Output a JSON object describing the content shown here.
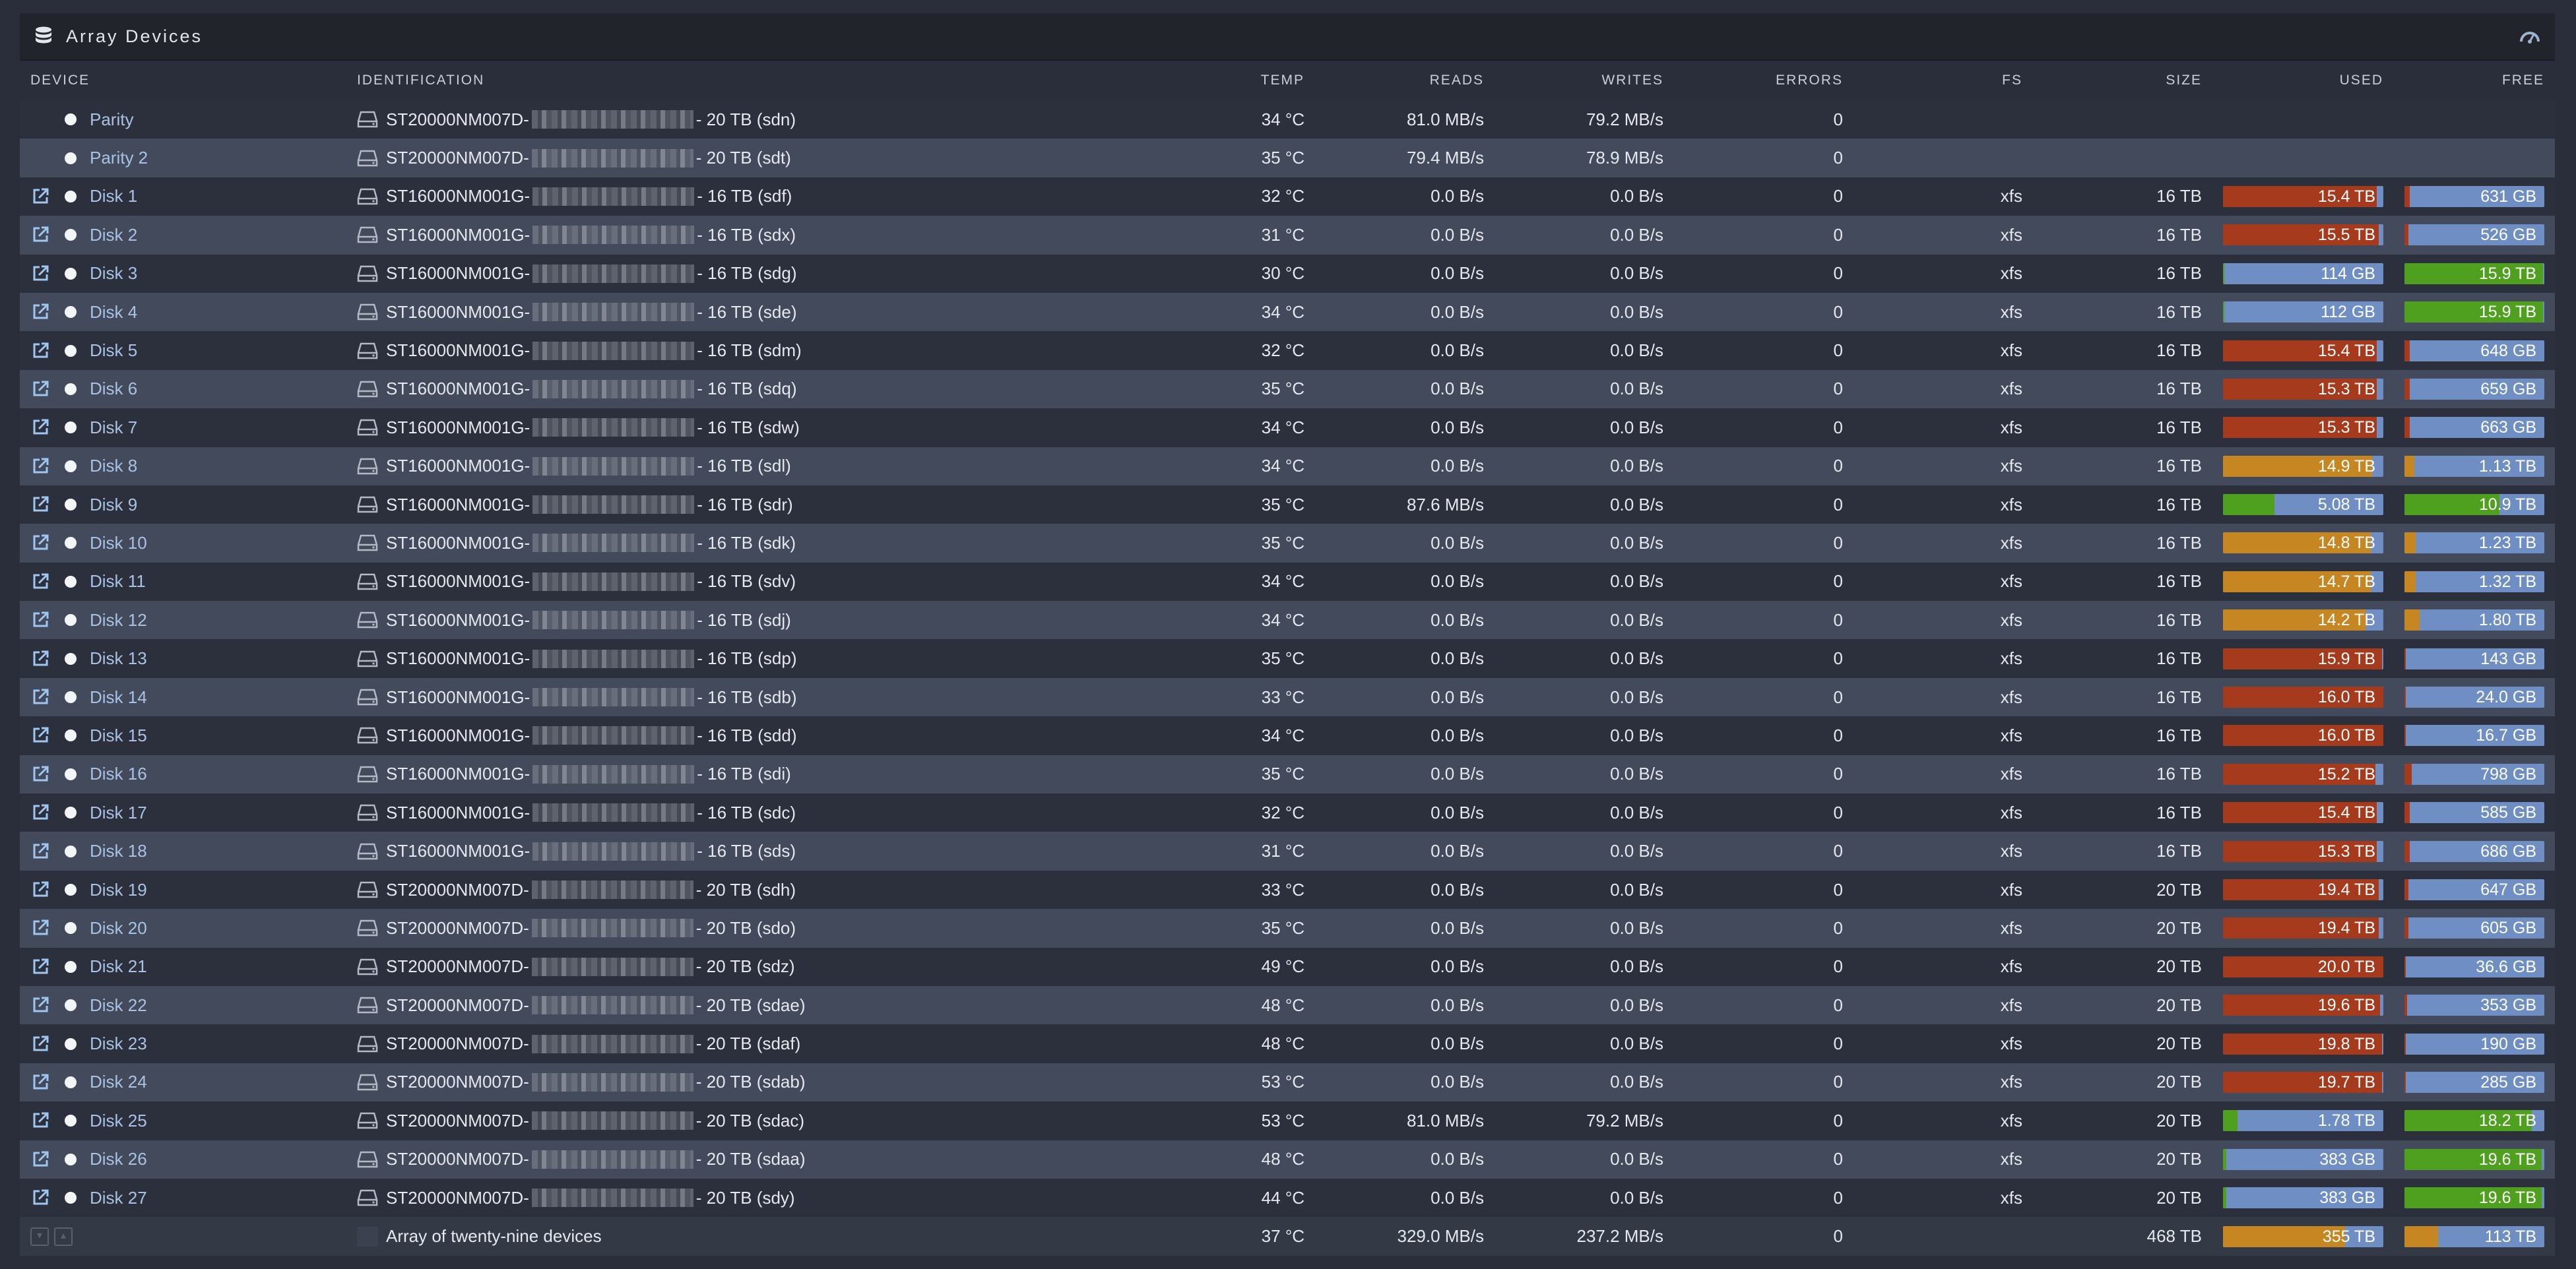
{
  "panel": {
    "title": "Array Devices",
    "icon": "database-icon",
    "settings_icon": "gauge-icon"
  },
  "columns": {
    "device": "DEVICE",
    "identification": "IDENTIFICATION",
    "temp": "TEMP",
    "reads": "READS",
    "writes": "WRITES",
    "errors": "ERRORS",
    "fs": "FS",
    "size": "SIZE",
    "used": "USED",
    "free": "FREE"
  },
  "colors": {
    "red": "#a53a1d",
    "orange": "#c68622",
    "green": "#4fa01e",
    "blue": "#6f8fc4",
    "row_odd": "#2c303c",
    "row_even": "#434a5c"
  },
  "rows": [
    {
      "name": "Parity",
      "link": false,
      "model": "ST20000NM007D-",
      "suffix": "- 20 TB (sdn)",
      "temp": "34 °C",
      "reads": "81.0 MB/s",
      "writes": "79.2 MB/s",
      "errors": "0",
      "fs": "",
      "size": "",
      "used": null,
      "free": null
    },
    {
      "name": "Parity 2",
      "link": false,
      "model": "ST20000NM007D-",
      "suffix": "- 20 TB (sdt)",
      "temp": "35 °C",
      "reads": "79.4 MB/s",
      "writes": "78.9 MB/s",
      "errors": "0",
      "fs": "",
      "size": "",
      "used": null,
      "free": null
    },
    {
      "name": "Disk 1",
      "link": true,
      "model": "ST16000NM001G-",
      "suffix": "- 16 TB (sdf)",
      "temp": "32 °C",
      "reads": "0.0 B/s",
      "writes": "0.0 B/s",
      "errors": "0",
      "fs": "xfs",
      "size": "16 TB",
      "used": {
        "label": "15.4 TB",
        "pct": 96,
        "color": "red"
      },
      "free": {
        "label": "631 GB",
        "pct": 4,
        "color": "red"
      }
    },
    {
      "name": "Disk 2",
      "link": true,
      "model": "ST16000NM001G-",
      "suffix": "- 16 TB (sdx)",
      "temp": "31 °C",
      "reads": "0.0 B/s",
      "writes": "0.0 B/s",
      "errors": "0",
      "fs": "xfs",
      "size": "16 TB",
      "used": {
        "label": "15.5 TB",
        "pct": 97,
        "color": "red"
      },
      "free": {
        "label": "526 GB",
        "pct": 3,
        "color": "red"
      }
    },
    {
      "name": "Disk 3",
      "link": true,
      "model": "ST16000NM001G-",
      "suffix": "- 16 TB (sdg)",
      "temp": "30 °C",
      "reads": "0.0 B/s",
      "writes": "0.0 B/s",
      "errors": "0",
      "fs": "xfs",
      "size": "16 TB",
      "used": {
        "label": "114 GB",
        "pct": 1,
        "color": "green"
      },
      "free": {
        "label": "15.9 TB",
        "pct": 99,
        "color": "green"
      }
    },
    {
      "name": "Disk 4",
      "link": true,
      "model": "ST16000NM001G-",
      "suffix": "- 16 TB (sde)",
      "temp": "34 °C",
      "reads": "0.0 B/s",
      "writes": "0.0 B/s",
      "errors": "0",
      "fs": "xfs",
      "size": "16 TB",
      "used": {
        "label": "112 GB",
        "pct": 1,
        "color": "green"
      },
      "free": {
        "label": "15.9 TB",
        "pct": 99,
        "color": "green"
      }
    },
    {
      "name": "Disk 5",
      "link": true,
      "model": "ST16000NM001G-",
      "suffix": "- 16 TB (sdm)",
      "temp": "32 °C",
      "reads": "0.0 B/s",
      "writes": "0.0 B/s",
      "errors": "0",
      "fs": "xfs",
      "size": "16 TB",
      "used": {
        "label": "15.4 TB",
        "pct": 96,
        "color": "red"
      },
      "free": {
        "label": "648 GB",
        "pct": 4,
        "color": "red"
      }
    },
    {
      "name": "Disk 6",
      "link": true,
      "model": "ST16000NM001G-",
      "suffix": "- 16 TB (sdq)",
      "temp": "35 °C",
      "reads": "0.0 B/s",
      "writes": "0.0 B/s",
      "errors": "0",
      "fs": "xfs",
      "size": "16 TB",
      "used": {
        "label": "15.3 TB",
        "pct": 96,
        "color": "red"
      },
      "free": {
        "label": "659 GB",
        "pct": 4,
        "color": "red"
      }
    },
    {
      "name": "Disk 7",
      "link": true,
      "model": "ST16000NM001G-",
      "suffix": "- 16 TB (sdw)",
      "temp": "34 °C",
      "reads": "0.0 B/s",
      "writes": "0.0 B/s",
      "errors": "0",
      "fs": "xfs",
      "size": "16 TB",
      "used": {
        "label": "15.3 TB",
        "pct": 96,
        "color": "red"
      },
      "free": {
        "label": "663 GB",
        "pct": 4,
        "color": "red"
      }
    },
    {
      "name": "Disk 8",
      "link": true,
      "model": "ST16000NM001G-",
      "suffix": "- 16 TB (sdl)",
      "temp": "34 °C",
      "reads": "0.0 B/s",
      "writes": "0.0 B/s",
      "errors": "0",
      "fs": "xfs",
      "size": "16 TB",
      "used": {
        "label": "14.9 TB",
        "pct": 93,
        "color": "orange"
      },
      "free": {
        "label": "1.13 TB",
        "pct": 7,
        "color": "orange"
      }
    },
    {
      "name": "Disk 9",
      "link": true,
      "model": "ST16000NM001G-",
      "suffix": "- 16 TB (sdr)",
      "temp": "35 °C",
      "reads": "87.6 MB/s",
      "writes": "0.0 B/s",
      "errors": "0",
      "fs": "xfs",
      "size": "16 TB",
      "used": {
        "label": "5.08 TB",
        "pct": 32,
        "color": "green"
      },
      "free": {
        "label": "10.9 TB",
        "pct": 68,
        "color": "green"
      }
    },
    {
      "name": "Disk 10",
      "link": true,
      "model": "ST16000NM001G-",
      "suffix": "- 16 TB (sdk)",
      "temp": "35 °C",
      "reads": "0.0 B/s",
      "writes": "0.0 B/s",
      "errors": "0",
      "fs": "xfs",
      "size": "16 TB",
      "used": {
        "label": "14.8 TB",
        "pct": 92,
        "color": "orange"
      },
      "free": {
        "label": "1.23 TB",
        "pct": 8,
        "color": "orange"
      }
    },
    {
      "name": "Disk 11",
      "link": true,
      "model": "ST16000NM001G-",
      "suffix": "- 16 TB (sdv)",
      "temp": "34 °C",
      "reads": "0.0 B/s",
      "writes": "0.0 B/s",
      "errors": "0",
      "fs": "xfs",
      "size": "16 TB",
      "used": {
        "label": "14.7 TB",
        "pct": 92,
        "color": "orange"
      },
      "free": {
        "label": "1.32 TB",
        "pct": 8,
        "color": "orange"
      }
    },
    {
      "name": "Disk 12",
      "link": true,
      "model": "ST16000NM001G-",
      "suffix": "- 16 TB (sdj)",
      "temp": "34 °C",
      "reads": "0.0 B/s",
      "writes": "0.0 B/s",
      "errors": "0",
      "fs": "xfs",
      "size": "16 TB",
      "used": {
        "label": "14.2 TB",
        "pct": 89,
        "color": "orange"
      },
      "free": {
        "label": "1.80 TB",
        "pct": 11,
        "color": "orange"
      }
    },
    {
      "name": "Disk 13",
      "link": true,
      "model": "ST16000NM001G-",
      "suffix": "- 16 TB (sdp)",
      "temp": "35 °C",
      "reads": "0.0 B/s",
      "writes": "0.0 B/s",
      "errors": "0",
      "fs": "xfs",
      "size": "16 TB",
      "used": {
        "label": "15.9 TB",
        "pct": 99,
        "color": "red"
      },
      "free": {
        "label": "143 GB",
        "pct": 1,
        "color": "red"
      }
    },
    {
      "name": "Disk 14",
      "link": true,
      "model": "ST16000NM001G-",
      "suffix": "- 16 TB (sdb)",
      "temp": "33 °C",
      "reads": "0.0 B/s",
      "writes": "0.0 B/s",
      "errors": "0",
      "fs": "xfs",
      "size": "16 TB",
      "used": {
        "label": "16.0 TB",
        "pct": 100,
        "color": "red"
      },
      "free": {
        "label": "24.0 GB",
        "pct": 0,
        "color": "red"
      }
    },
    {
      "name": "Disk 15",
      "link": true,
      "model": "ST16000NM001G-",
      "suffix": "- 16 TB (sdd)",
      "temp": "34 °C",
      "reads": "0.0 B/s",
      "writes": "0.0 B/s",
      "errors": "0",
      "fs": "xfs",
      "size": "16 TB",
      "used": {
        "label": "16.0 TB",
        "pct": 100,
        "color": "red"
      },
      "free": {
        "label": "16.7 GB",
        "pct": 0,
        "color": "red"
      }
    },
    {
      "name": "Disk 16",
      "link": true,
      "model": "ST16000NM001G-",
      "suffix": "- 16 TB (sdi)",
      "temp": "35 °C",
      "reads": "0.0 B/s",
      "writes": "0.0 B/s",
      "errors": "0",
      "fs": "xfs",
      "size": "16 TB",
      "used": {
        "label": "15.2 TB",
        "pct": 95,
        "color": "red"
      },
      "free": {
        "label": "798 GB",
        "pct": 5,
        "color": "red"
      }
    },
    {
      "name": "Disk 17",
      "link": true,
      "model": "ST16000NM001G-",
      "suffix": "- 16 TB (sdc)",
      "temp": "32 °C",
      "reads": "0.0 B/s",
      "writes": "0.0 B/s",
      "errors": "0",
      "fs": "xfs",
      "size": "16 TB",
      "used": {
        "label": "15.4 TB",
        "pct": 96,
        "color": "red"
      },
      "free": {
        "label": "585 GB",
        "pct": 4,
        "color": "red"
      }
    },
    {
      "name": "Disk 18",
      "link": true,
      "model": "ST16000NM001G-",
      "suffix": "- 16 TB (sds)",
      "temp": "31 °C",
      "reads": "0.0 B/s",
      "writes": "0.0 B/s",
      "errors": "0",
      "fs": "xfs",
      "size": "16 TB",
      "used": {
        "label": "15.3 TB",
        "pct": 96,
        "color": "red"
      },
      "free": {
        "label": "686 GB",
        "pct": 4,
        "color": "red"
      }
    },
    {
      "name": "Disk 19",
      "link": true,
      "model": "ST20000NM007D-",
      "suffix": "- 20 TB (sdh)",
      "temp": "33 °C",
      "reads": "0.0 B/s",
      "writes": "0.0 B/s",
      "errors": "0",
      "fs": "xfs",
      "size": "20 TB",
      "used": {
        "label": "19.4 TB",
        "pct": 97,
        "color": "red"
      },
      "free": {
        "label": "647 GB",
        "pct": 3,
        "color": "red"
      }
    },
    {
      "name": "Disk 20",
      "link": true,
      "model": "ST20000NM007D-",
      "suffix": "- 20 TB (sdo)",
      "temp": "35 °C",
      "reads": "0.0 B/s",
      "writes": "0.0 B/s",
      "errors": "0",
      "fs": "xfs",
      "size": "20 TB",
      "used": {
        "label": "19.4 TB",
        "pct": 97,
        "color": "red"
      },
      "free": {
        "label": "605 GB",
        "pct": 3,
        "color": "red"
      }
    },
    {
      "name": "Disk 21",
      "link": true,
      "model": "ST20000NM007D-",
      "suffix": "- 20 TB (sdz)",
      "temp": "49 °C",
      "reads": "0.0 B/s",
      "writes": "0.0 B/s",
      "errors": "0",
      "fs": "xfs",
      "size": "20 TB",
      "used": {
        "label": "20.0 TB",
        "pct": 100,
        "color": "red"
      },
      "free": {
        "label": "36.6 GB",
        "pct": 0,
        "color": "red"
      }
    },
    {
      "name": "Disk 22",
      "link": true,
      "model": "ST20000NM007D-",
      "suffix": "- 20 TB (sdae)",
      "temp": "48 °C",
      "reads": "0.0 B/s",
      "writes": "0.0 B/s",
      "errors": "0",
      "fs": "xfs",
      "size": "20 TB",
      "used": {
        "label": "19.6 TB",
        "pct": 98,
        "color": "red"
      },
      "free": {
        "label": "353 GB",
        "pct": 2,
        "color": "red"
      }
    },
    {
      "name": "Disk 23",
      "link": true,
      "model": "ST20000NM007D-",
      "suffix": "- 20 TB (sdaf)",
      "temp": "48 °C",
      "reads": "0.0 B/s",
      "writes": "0.0 B/s",
      "errors": "0",
      "fs": "xfs",
      "size": "20 TB",
      "used": {
        "label": "19.8 TB",
        "pct": 99,
        "color": "red"
      },
      "free": {
        "label": "190 GB",
        "pct": 1,
        "color": "red"
      }
    },
    {
      "name": "Disk 24",
      "link": true,
      "model": "ST20000NM007D-",
      "suffix": "- 20 TB (sdab)",
      "temp": "53 °C",
      "reads": "0.0 B/s",
      "writes": "0.0 B/s",
      "errors": "0",
      "fs": "xfs",
      "size": "20 TB",
      "used": {
        "label": "19.7 TB",
        "pct": 99,
        "color": "red"
      },
      "free": {
        "label": "285 GB",
        "pct": 1,
        "color": "red"
      }
    },
    {
      "name": "Disk 25",
      "link": true,
      "model": "ST20000NM007D-",
      "suffix": "- 20 TB (sdac)",
      "temp": "53 °C",
      "reads": "81.0 MB/s",
      "writes": "79.2 MB/s",
      "errors": "0",
      "fs": "xfs",
      "size": "20 TB",
      "used": {
        "label": "1.78 TB",
        "pct": 9,
        "color": "green"
      },
      "free": {
        "label": "18.2 TB",
        "pct": 91,
        "color": "green"
      }
    },
    {
      "name": "Disk 26",
      "link": true,
      "model": "ST20000NM007D-",
      "suffix": "- 20 TB (sdaa)",
      "temp": "48 °C",
      "reads": "0.0 B/s",
      "writes": "0.0 B/s",
      "errors": "0",
      "fs": "xfs",
      "size": "20 TB",
      "used": {
        "label": "383 GB",
        "pct": 2,
        "color": "green"
      },
      "free": {
        "label": "19.6 TB",
        "pct": 98,
        "color": "green"
      }
    },
    {
      "name": "Disk 27",
      "link": true,
      "model": "ST20000NM007D-",
      "suffix": "- 20 TB (sdy)",
      "temp": "44 °C",
      "reads": "0.0 B/s",
      "writes": "0.0 B/s",
      "errors": "0",
      "fs": "xfs",
      "size": "20 TB",
      "used": {
        "label": "383 GB",
        "pct": 2,
        "color": "green"
      },
      "free": {
        "label": "19.6 TB",
        "pct": 98,
        "color": "green"
      }
    }
  ],
  "footer": {
    "label": "Array of twenty-nine devices",
    "temp": "37 °C",
    "reads": "329.0 MB/s",
    "writes": "237.2 MB/s",
    "errors": "0",
    "size": "468 TB",
    "used": {
      "label": "355 TB",
      "pct": 76,
      "color": "orange"
    },
    "free": {
      "label": "113 TB",
      "pct": 24,
      "color": "orange"
    },
    "buttons": [
      "collapse-icon",
      "expand-icon"
    ]
  }
}
